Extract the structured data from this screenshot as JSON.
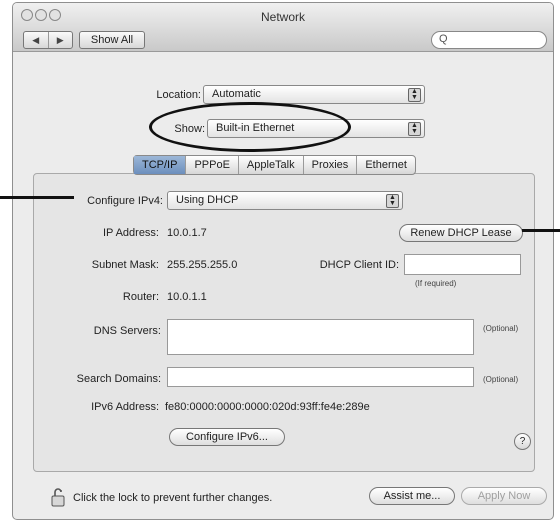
{
  "window": {
    "title": "Network",
    "show_all": "Show All",
    "nav_back": "◀",
    "nav_forward": "▶",
    "search_glass": "Q"
  },
  "location": {
    "label": "Location:",
    "value": "Automatic"
  },
  "show": {
    "label": "Show:",
    "value": "Built-in Ethernet"
  },
  "tabs": [
    {
      "label": "TCP/IP",
      "selected": true
    },
    {
      "label": "PPPoE",
      "selected": false
    },
    {
      "label": "AppleTalk",
      "selected": false
    },
    {
      "label": "Proxies",
      "selected": false
    },
    {
      "label": "Ethernet",
      "selected": false
    }
  ],
  "tcpip": {
    "configure_label": "Configure IPv4:",
    "configure_value": "Using DHCP",
    "ip_label": "IP Address:",
    "ip_value": "10.0.1.7",
    "renew_button": "Renew DHCP Lease",
    "subnet_label": "Subnet Mask:",
    "subnet_value": "255.255.255.0",
    "client_id_label": "DHCP Client ID:",
    "client_id_value": "",
    "if_required": "(If required)",
    "router_label": "Router:",
    "router_value": "10.0.1.1",
    "dns_label": "DNS Servers:",
    "dns_optional": "(Optional)",
    "search_label": "Search Domains:",
    "search_optional": "(Optional)",
    "ipv6_label": "IPv6 Address:",
    "ipv6_value": "fe80:0000:0000:0000:020d:93ff:fe4e:289e",
    "configure_ipv6_button": "Configure IPv6...",
    "help": "?"
  },
  "footer": {
    "lock_text": "Click the lock to prevent further changes.",
    "assist_button": "Assist me...",
    "apply_button": "Apply Now"
  }
}
